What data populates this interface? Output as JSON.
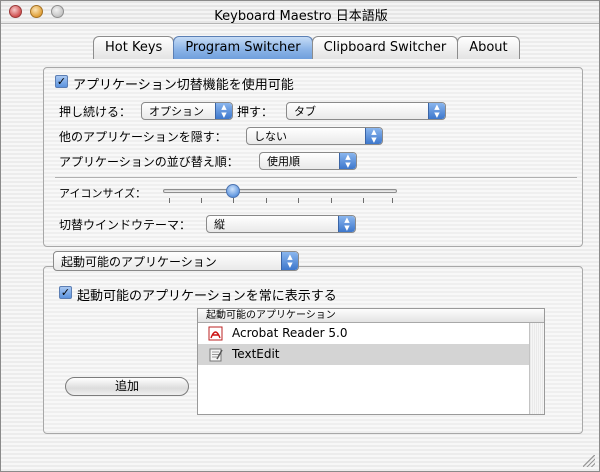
{
  "window": {
    "title": "Keyboard Maestro 日本語版"
  },
  "tabs": [
    {
      "label": "Hot Keys",
      "active": false
    },
    {
      "label": "Program Switcher",
      "active": true
    },
    {
      "label": "Clipboard Switcher",
      "active": false
    },
    {
      "label": "About",
      "active": false
    }
  ],
  "switcher": {
    "enable_label": "アプリケーション切替機能を使用可能",
    "enable_checked": true,
    "hold_label": "押し続ける：",
    "hold_value": "オプション",
    "press_label": "押す：",
    "press_value": "タブ",
    "hide_label": "他のアプリケーションを隠す：",
    "hide_value": "しない",
    "sort_label": "アプリケーションの並び替え順：",
    "sort_value": "使用順",
    "icon_size_label": "アイコンサイズ：",
    "icon_size_fraction": 0.27,
    "window_theme_label": "切替ウインドウテーマ：",
    "window_theme_value": "縦"
  },
  "launch": {
    "section_popup_value": "起動可能のアプリケーション",
    "always_show_label": "起動可能のアプリケーションを常に表示する",
    "always_show_checked": true,
    "list_header": "起動可能のアプリケーション",
    "apps": [
      {
        "name": "Acrobat Reader 5.0",
        "icon": "acrobat-icon",
        "selected": false
      },
      {
        "name": "TextEdit",
        "icon": "textedit-icon",
        "selected": true
      }
    ],
    "add_button": "追加"
  },
  "colors": {
    "accent": "#5b93de",
    "selection": "#d4d4d4"
  }
}
